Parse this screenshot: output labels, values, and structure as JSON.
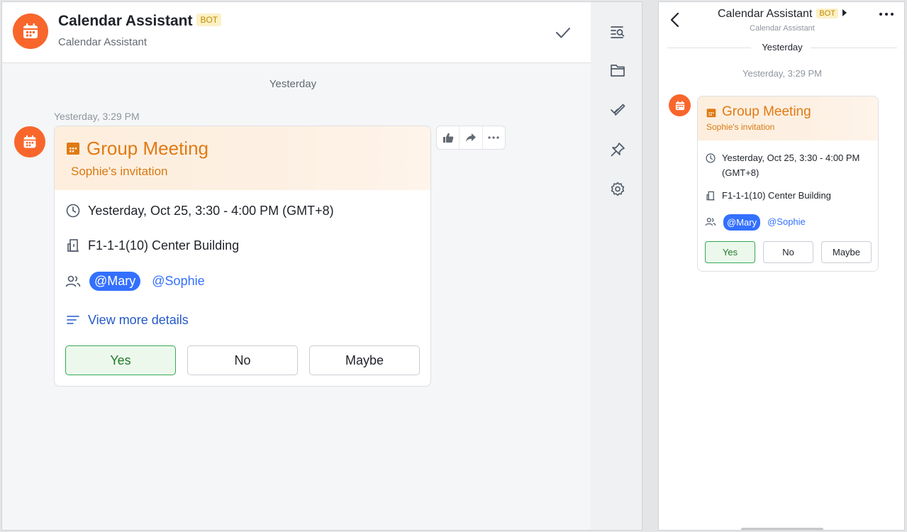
{
  "desktop": {
    "header": {
      "title": "Calendar Assistant",
      "badge": "BOT",
      "subtitle": "Calendar Assistant"
    },
    "chat": {
      "date_divider": "Yesterday",
      "timestamp": "Yesterday, 3:29 PM"
    },
    "card": {
      "title": "Group Meeting",
      "subtitle": "Sophie's invitation",
      "time": "Yesterday, Oct 25, 3:30 - 4:00 PM (GMT+8)",
      "location": "F1-1-1(10) Center Building",
      "attendees": [
        "@Mary",
        "@Sophie"
      ],
      "more_details": "View more details",
      "buttons": {
        "yes": "Yes",
        "no": "No",
        "maybe": "Maybe"
      }
    },
    "sidebar_icons": [
      "search-list-icon",
      "folder-icon",
      "edit-check-icon",
      "pin-icon",
      "settings-icon"
    ],
    "message_actions": [
      "thumbs-up-icon",
      "forward-icon",
      "more-icon"
    ]
  },
  "mobile": {
    "header": {
      "title": "Calendar Assistant",
      "badge": "BOT",
      "subtitle": "Calendar Assistant"
    },
    "date_divider": "Yesterday",
    "timestamp": "Yesterday, 3:29 PM",
    "card": {
      "title": "Group Meeting",
      "subtitle": "Sophie's invitation",
      "time_line1": "Yesterday, Oct 25, 3:30 - 4:00 PM",
      "time_line2": "(GMT+8)",
      "location": "F1-1-1(10) Center Building",
      "attendees": [
        "@Mary",
        "@Sophie"
      ],
      "buttons": {
        "yes": "Yes",
        "no": "No",
        "maybe": "Maybe"
      }
    }
  },
  "colors": {
    "accent_orange": "#f8662c",
    "card_title": "#e07a13",
    "mention_blue": "#3370ff",
    "yes_green": "#34a853",
    "badge_bg": "#fcf0c5"
  }
}
